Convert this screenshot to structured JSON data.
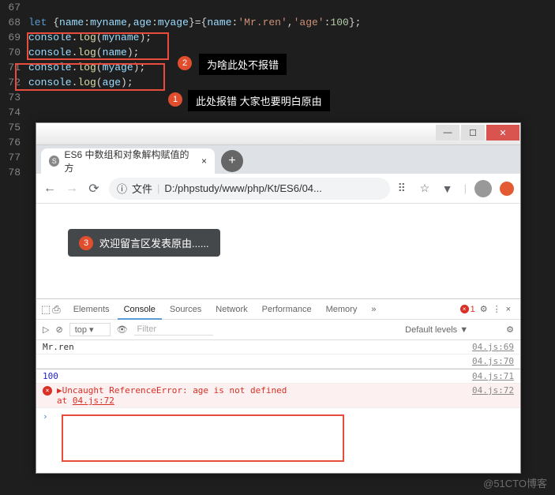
{
  "code": {
    "l68": "let {name:myname,age:myage}={name:'Mr.ren','age':100};",
    "l69": "console.log(myname);",
    "l70": "console.log(name);",
    "l71": "console.log(myage);",
    "l72": "console.log(age);"
  },
  "gutter": {
    "g67": "67",
    "g68": "68",
    "g69": "69",
    "g70": "70",
    "g71": "71",
    "g72": "72",
    "g73": "73",
    "g74": "74",
    "g75": "75",
    "g76": "76",
    "g77": "77",
    "g78": "78"
  },
  "badges": {
    "b1": "1",
    "b2": "2",
    "b3": "3"
  },
  "annotations": {
    "a2": "为啥此处不报错",
    "a1": "此处报错 大家也要明白原由",
    "a3": "欢迎留言区发表原由......"
  },
  "browser": {
    "tab_title": "ES6 中数组和对象解构赋值的方",
    "tab_close": "×",
    "new_tab": "+",
    "nav": {
      "back": "←",
      "fwd": "→",
      "reload": "⟳"
    },
    "addr": {
      "file_icon": "ⓘ",
      "file_label": "文件",
      "url": "D:/phpstudy/www/php/Kt/ES6/04...",
      "translate": "⠿",
      "star": "☆",
      "more": "▼"
    }
  },
  "devtools": {
    "tabs": {
      "elements": "Elements",
      "console": "Console",
      "sources": "Sources",
      "network": "Network",
      "performance": "Performance",
      "memory": "Memory",
      "more": "»"
    },
    "errcount": "1",
    "settings": "⚙",
    "menu": "⋮",
    "close": "×",
    "inspect": "⬚",
    "device": "⎙",
    "play": "▷",
    "clear": "⊘",
    "context": "top",
    "ctx_arrow": "▾",
    "eye": "👁",
    "filter_ph": "Filter",
    "levels": "Default levels ▼",
    "gear2": "⚙"
  },
  "console": {
    "r1": {
      "text": "Mr.ren",
      "src": "04.js:69"
    },
    "r2": {
      "text": " ",
      "src": "04.js:70"
    },
    "r3": {
      "text": "100",
      "src": "04.js:71"
    },
    "err": {
      "arrow": "▶",
      "msg": "Uncaught ReferenceError: age is not defined",
      "at": "    at ",
      "loc": "04.js:72",
      "src": "04.js:72"
    },
    "prompt": "›"
  },
  "watermark": "@51CTO博客"
}
